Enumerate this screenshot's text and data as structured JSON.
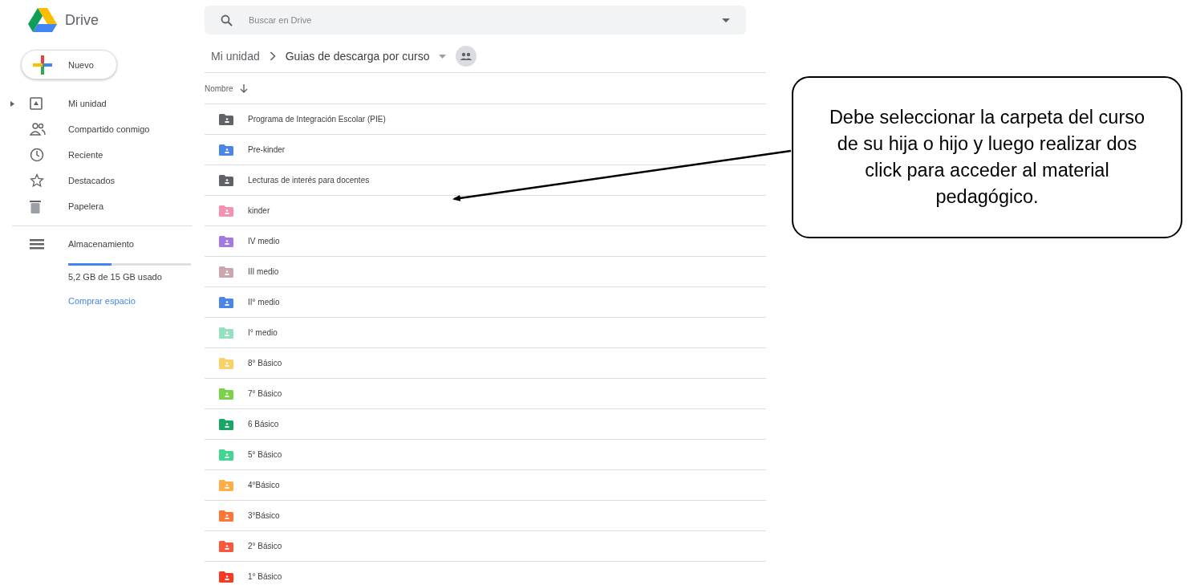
{
  "app": {
    "name": "Drive"
  },
  "new_button": {
    "label": "Nuevo"
  },
  "sidebar": {
    "items": [
      {
        "label": "Mi unidad",
        "kind": "drive",
        "expandable": true
      },
      {
        "label": "Compartido conmigo",
        "kind": "shared",
        "expandable": false
      },
      {
        "label": "Reciente",
        "kind": "recent",
        "expandable": false
      },
      {
        "label": "Destacados",
        "kind": "starred",
        "expandable": false
      },
      {
        "label": "Papelera",
        "kind": "trash",
        "expandable": false
      }
    ],
    "storage": {
      "label": "Almacenamiento",
      "level": 0.35,
      "usage": "5,2 GB de 15 GB usado",
      "link": "Comprar espacio"
    }
  },
  "search": {
    "placeholder": "Buscar en Drive"
  },
  "breadcrumb": {
    "root": "Mi unidad",
    "current": "Guias de descarga por curso"
  },
  "table": {
    "columns": [
      "Nombre"
    ],
    "rows": [
      {
        "name": "Programa de Integración Escolar (PIE)",
        "color": "#5f6368"
      },
      {
        "name": "Pre-kinder",
        "color": "#4986e7"
      },
      {
        "name": "Lecturas de interés para docentes",
        "color": "#5f6368"
      },
      {
        "name": "kinder",
        "color": "#f691b2"
      },
      {
        "name": "IV medio",
        "color": "#a47ae2"
      },
      {
        "name": "III medio",
        "color": "#cca6ac"
      },
      {
        "name": "II° medio",
        "color": "#4986e7"
      },
      {
        "name": "I° medio",
        "color": "#92e1c0"
      },
      {
        "name": "8° Básico",
        "color": "#fad165"
      },
      {
        "name": "7° Básico",
        "color": "#7bd148"
      },
      {
        "name": "6 Básico",
        "color": "#16a765"
      },
      {
        "name": "5° Básico",
        "color": "#42d692"
      },
      {
        "name": "4°Básico",
        "color": "#ffad46"
      },
      {
        "name": "3°Básico",
        "color": "#ff7537"
      },
      {
        "name": "2° Básico",
        "color": "#fa573c"
      },
      {
        "name": "1° Básico",
        "color": "#f83a22"
      }
    ]
  },
  "callout": {
    "text": "Debe seleccionar la carpeta del curso de su hija o hijo y luego realizar dos click para acceder al material pedagógico."
  }
}
